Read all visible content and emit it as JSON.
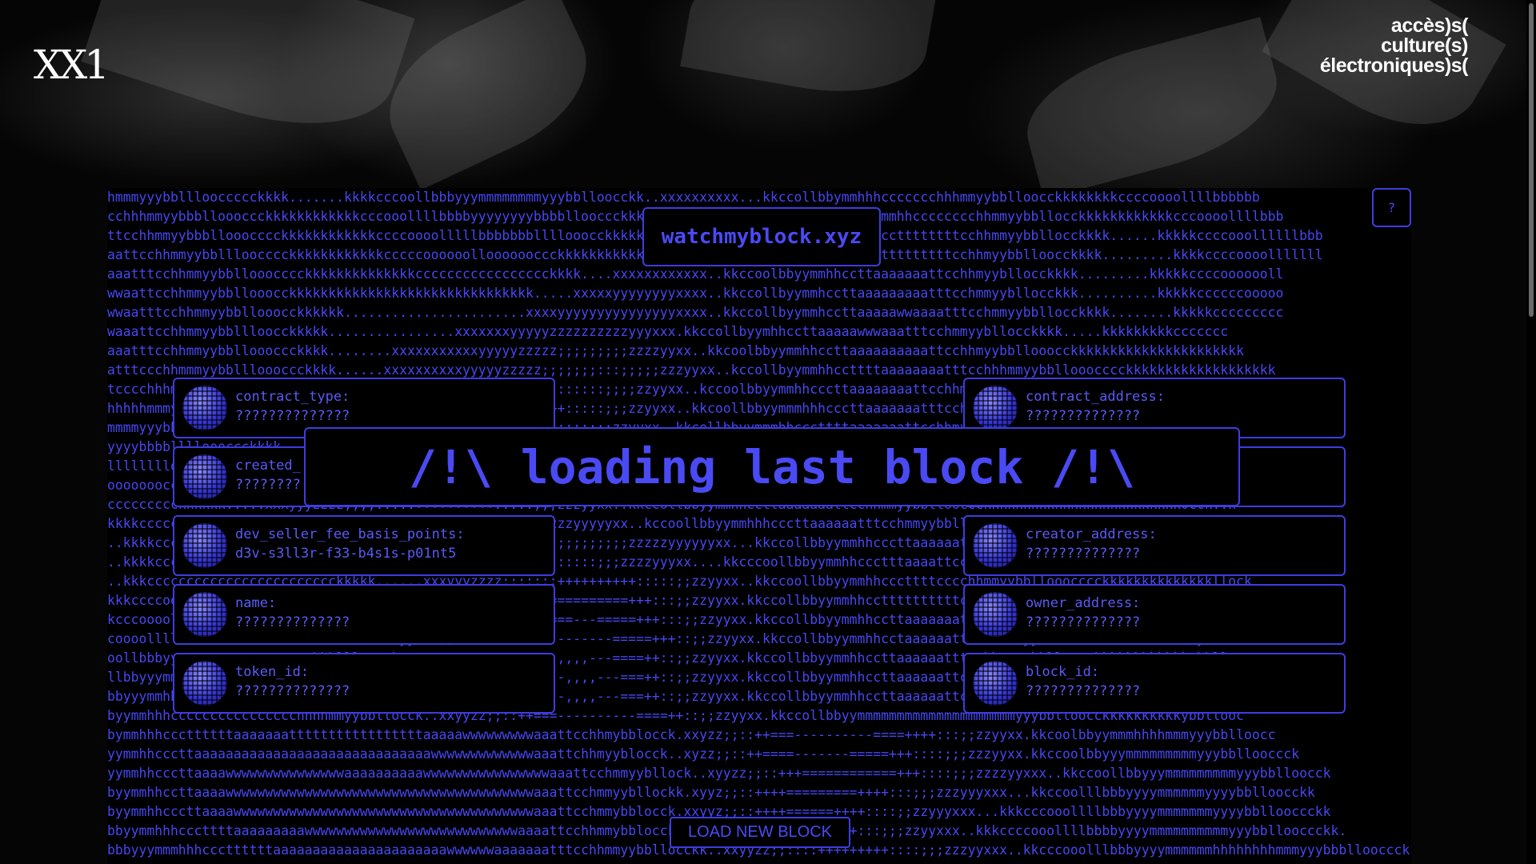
{
  "header": {
    "logo": "XX1",
    "tagline": [
      "accès)s(",
      "culture(s)",
      "électroniques)s("
    ]
  },
  "site_label": "watchmyblock.xyz",
  "help_label": "?",
  "loading_text": "/!\\ loading last block /!\\",
  "load_button_label": "LOAD NEW BLOCK",
  "cards": [
    {
      "key": "contract_type:",
      "value": "??????????????"
    },
    {
      "key": "contract_address:",
      "value": "??????????????"
    },
    {
      "key": "created_",
      "value": "????????"
    },
    {
      "key": "",
      "value": ""
    },
    {
      "key": "dev_seller_fee_basis_points:",
      "value": "d3v-s3ll3r-f33-b4s1s-p01nt5"
    },
    {
      "key": "creator_address:",
      "value": "??????????????"
    },
    {
      "key": "name:",
      "value": "??????????????"
    },
    {
      "key": "owner_address:",
      "value": "??????????????"
    },
    {
      "key": "token_id:",
      "value": "??????????????"
    },
    {
      "key": "block_id:",
      "value": "??????????????"
    }
  ],
  "ascii_lines": [
    "hmmmyyybblllooccccckkkk.......kkkkcccoollbbbyyymmmmmmmmyyybblloocckk..xxxxxxxxxx...kkccollbbymmhhhccccccchhhmmyybblloocckkkkkkkkccccoooollllbbbbbb",
    "cchhhmmyybbblloooccckkkkkkkkkkkkcccooollllbbbbyyyyyyyybbbbllooccckkkkkkkkkkkkkkkkkkkkkkkkkkkkcccyymmhhcccccccchhmmyybbllocckkkkkkkkkkkkcccoooollllbbb",
    "ttcchhmmyybbbllooocccckkkkkkkkkkkkccccoooolllllbbbbbbbllllooocckkkkkkkkkkkkkkkkkkkkkkkkkkkkkkymhhcccttttttttcchhmmyybbllocckkkk......kkkkkccccooollllllbbb",
    "aattcchhmmyybbllloocccckkkkkkkkkkkkcccccoooooollooooooccckkkkkkkkkkkkkkkkkkkkkkkkkkkkkkkkkkkmhhccttttttttttcchhmyybblloocckkkk.........kkkkccccoooolllllll",
    "aaatttcchhmmyybbllooocccckkkkkkkkkkkkkkccccccccccccccccckkkk....xxxxxxxxxxxx..kkccoolbbyymmhhccttaaaaaaattcchhmyybllocckkkk.........kkkkkccccooooooll",
    "wwaattcchhmmyybbllooocckkkkkkkkkkkkkkkkkkkkkkkkkkkkkkk.....xxxxxyyyyyyyyxxxx..kkccollbyymmhccttaaaaaaaaatttcchmmyybllocckkk..........kkkkkccccccooooo",
    "wwaatttcchhmmyybbllooocckkkkkk.......................xxxxyyyyyyyyyyyyyyyxxxx..kkccollbyymmhccttaaaaawwaaaatttcchmmyybbllocckkkk........kkkkkccccccccc",
    "waaattcchhmmyybbllloocckkkkk................xxxxxxxyyyyyzzzzzzzzzzyyyxxx.kkccollbyymhhccttaaaaawwwaaatttcchmmyybllocckkkk.....kkkkkkkkkccccccc",
    "aaatttcchhmmyybblloooccckkkk........xxxxxxxxxxxyyyyyzzzzz;;;;;;;;;zzzzyyxx..kkcoolbbyymmhhccttaaaaaaaaaattcchhmyybbllooocckkkkkkkkkkkkkkkkkkkkkk",
    "atttccchhmmmyybbllloooccckkkk......xxxxxxxxxxyyyyyzzzzz;;;;;;;:::;;;;;zzzyyxx..kccollbyymmhhccttttaaaaaaaatttcchhhmmyybbllooocccckkkkkkkkkkkkkkkkkkk",
    "tcccchhhmmyybbllloooccckkkkkk.....xxxxxxyyyyzzzz;;;;;::::::::::;;;;zzyyxx..kccoolbbyymmhhcccttaaaaaaaattcchhmmyybbllooccckkkkkkkkkkkkkkkkkkkk....",
    "hhhhhmmmyybbbllloooccckkkk.....xxxxxyyyyzzzz;;;;;;::::++++:::::;;;zzyyxx..kkcoollbbyymmmhhhcccttaaaaaaatttcchhmmyybbllloocckkkkkkkkkkkkkkkkk.....",
    "mmmmyyybbblllooocccckkkk.....xxxxyyyzzzz;;;;:::::+++++++:::::;;;zzyyxx..kkcollbbyymmmhhcccttttaaaaaaattcchhmyybbllooocckkkkkkkkkkkkkkkkkkkkk.....",
    "yyyybbbblllloooccckkkk....xxxxyyyzzz;;;;:::+++=====++++:::;;zzzyyxx..kkccollbbyymmhhccttttaaaaaattcchhmyybbllooccckkkkkkkkkkkkkkkkkkkkkkkkk...x",
    "llllllllooocccckkkk....xxxyyyzzz;;;::++++=======+++++:::;;;zzyyxx..kkccollbyymmhhcccttaaaaaaatttcchmmyybblloocckkkkkkkkkkkkkkkkkkkkkkkkkkk..x",
    "ooooooocccckkkkk....xxxyyyzzz;;;:::+++===========+++::::;;zzyyxx..kkcollbyymmhhhcccttaaaaaatttcchhmmyybbllooocckkkkkkkkkkkkkkkkkkkkkkkkkkckk..x",
    "ccccccccckkkkkk.....xxxyyyzzzz;;;;:::::++++++++++:::::;;;zzzyyxx..kkccollbbyymmhhccttaaaaaaattcchhmmyybbllooccckkkkkkkkkkkkkkkkkkkkkkkkkocck..x",
    "kkkkccccccccckkkkkk.....xxxxyyyyzzzz;;;;;;::::::;;;;;;zzzzzyyyyyxx..kccoollbbyymmhhhcccttaaaaaatttcchmmyybbllooocckkkkkkkkkkkkkkkkkkkkkkoocck.",
    "..kkkkcccccccccccccckkkkkk......xxxxxxxyyyyyzzzzz;;;;;;;;;;;;;;;;;zzzzzyyyyyyxx...kkccollbbyymmhhcccttaaaaaattcchmmyybllooocckkkkkkkkkkkkkkkkkloock.",
    "..kkkkccccccccccccccckkkkkkkkkk.....xxxyyyzzzz;;;:::::::::::::;;;zzzzyyyxx....kkcccoollbbyymmhhccctttaaaattcchmmyybbllooocccckkkkkkkkkkkkkkkkllock.",
    "..kkkcccccccccccccccccccccccckkkkk......xxxyyyzzzz;;;::::++++++++++:::::;;zzyyxx..kkccoollbbyymmhhcccttttcccchhmmyybbllooocccckkkkkkkkkkkkkkllock",
    "kkkccccooooooooooooooooocccckkkkkkkk.....xxyyzzz;;:::+++==========+++:::;;zzyyxx.kkccollbbyymmhhccttttttttttcchhmmyybblloooccccckkkkkkkkkkkkyybllock",
    "kcccoooollllllllllllllllloooccckk..xxyyyyzzz;;:::+++=======---=====+++:::;;zzyyxx.kkccollbbyymmhhccttaaaaaaattcchhmmyybbllooocccckkkkkkkkkkybblocc",
    "coooolllllbbbbbbbbbbbbbbbllloocckk.xxyyzzz;;::+++=====----------=====+++::;;zzyyxx.kkccollbbyymmhhcctaaaaaatttcchhmmyybbllooocckkkkkkkkkkkybblloc",
    "oollbbbyyyyyyyyyyyyyyyyyyybbbllloocck.xxyyzzz;;::++===---,,,,---====++::;;zzyyxx.kkccollbbyymmhhccttaaaaaatttcchhmmyybblloocckkkkkkkkkkkkybblloc",
    "llbbyyymmmmmmmmmmmmmmmmmyyybbllloocck.xxyyzz;;::++===-----,,,,---===++::;;zzyyxx.kkccollbbyymmhhccttaaaaaattcchhmmyybblloocckkkkkkkkkkkkkybblloc",
    "bbyyymmhhhhhhhhhhhhhhhmmmyyybblloocck.xxyyzz;;::++===-----,,,,---===++::;;zzyyxx.kkccollbbyymmhhccttaaaaaattcchhmmyybbllooccckkkkkkkkkkkybblloc",
    "byymmhhhcccccccccccccccchhhhmmyybbllocck..xxyyzz;;::++===----------====++::;;zzyyxx.kkccollbbyymmmmmmmmmmmmmmmmmmmmyyybblloocckkkkkkkkkkybbllooc",
    "bymmhhhcccttttttaaaaaaatttttttttttttttttaaaaawwwwwwwwwaaattcchhmybblocck.xxyzz;;::++===----------====++++:::;;zzyyxx.kkcoolbbyymmmhhhhmmmyyybblloocc",
    "yymmhhcccttaaaaaaaaaaaaaaaaaaaaaaaaaaaaaawwwwwwwwwwwwwaaattchhmyyblocck..xyzz;;::++====-------=====+++::::;;;zzzyyxx.kkccoolbbyyymmmmmmmmmyyybbllooccck",
    "yymmhhcccttaaaawwwwwwwwwwwwwwwaaaaaaaaaawwwwwwwwwwwwwwwwaaattcchmmyybllock..xyyzz;;::+++============+++::::;;;zzzzyyxxx..kkccoollbbyyymmmmmmmmmyyybblloocck",
    "byymmhhccttaaaawwwwwwwwwwwwwwwwwwwwwwwwwwwwwwwwwwwwwwwaaattcchmmyybllockk.xyyz;;::++++=========++++:::;;;zzzyyyxxx...kkccoolllbbbyyyymmmmmmyyyybblloocckk",
    "byymmhhcccttaaaawwwwwwwwwwwwwwwwwwwwwwwwwwwwwwwwwwwwwwaaattcchmmybblocck.xxyyz;;::++++======++++::::;;zzyyyxxx...kkkcccooollllbbbyyyymmmmmmmyyyybbllooccckk",
    "bbyymmhhhcccttttaaaaaaaaawwwwwwwwwwwwwwwwwwwwwwwwwwwaaaattcchhmmybblocck.xxyyzz;;::++++====++++:::;;;zzyyxxx..kkkccccooollllbbbbyyyymmmmmmmmmmyyybbllooccckk.",
    "bbbyyymmmhhhcccttttttaaaaaaaaaaaaaaaaaaaaaawwwwwwaaaaaaatttcchhmmyybbllocckk..xxyyzz;;::::+++++++++::::;;;zzzyyxxx..kkcccooolllbbbyyyymmmmmmhhhhhhhhmmmyyybbbllooccck."
  ]
}
